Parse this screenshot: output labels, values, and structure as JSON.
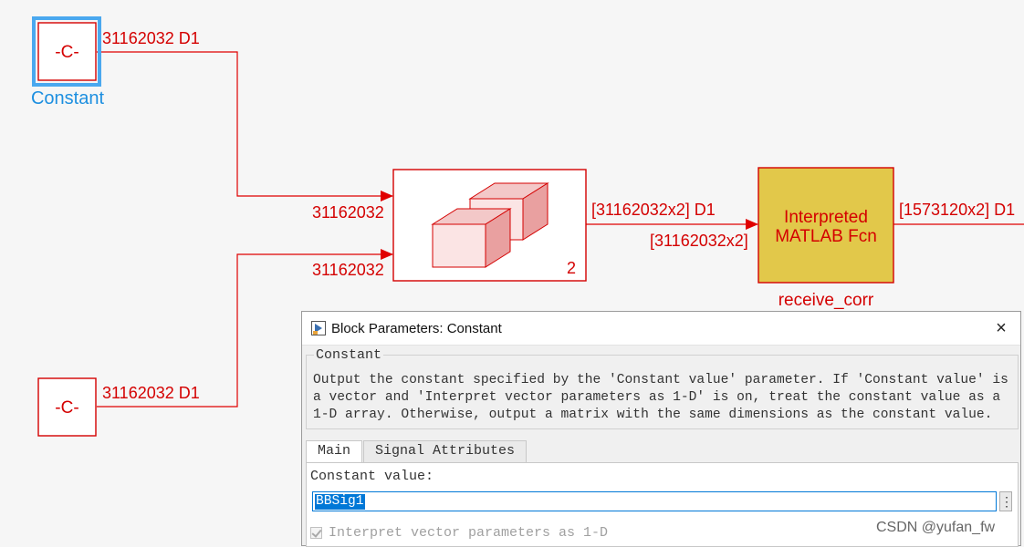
{
  "diagram": {
    "constant_block_1": {
      "symbol": "-C-",
      "name": "Constant",
      "output_signal": "31162032 D1"
    },
    "constant_block_2": {
      "symbol": "-C-",
      "output_signal": "31162032 D1"
    },
    "concatenate_block": {
      "input_1_dims": "31162032",
      "input_2_dims": "31162032",
      "num_inputs": "2",
      "output_signal": "[31162032x2] D1"
    },
    "interpreted_block": {
      "line1": "Interpreted",
      "line2": "MATLAB Fcn",
      "name": "receive_corr",
      "input_dims": "[31162032x2]",
      "output_signal": "[1573120x2] D1"
    }
  },
  "dialog": {
    "title": "Block Parameters: Constant",
    "close_symbol": "×",
    "group_title": "Constant",
    "description": "Output the constant specified by the 'Constant value' parameter. If 'Constant value' is a vector and 'Interpret vector parameters as 1-D' is on, treat the constant value as a 1-D array. Otherwise, output a matrix with the same dimensions as the constant value.",
    "tabs": [
      {
        "label": "Main",
        "active": true
      },
      {
        "label": "Signal Attributes",
        "active": false
      }
    ],
    "constant_value_label": "Constant value:",
    "constant_value": "BBSig1",
    "browse_symbol": "⋮",
    "checkbox_label": "Interpret vector parameters as 1-D",
    "checkbox_checked": true
  },
  "watermark": "CSDN @yufan_fw",
  "colors": {
    "signal_red": "#d40000",
    "block_fill_yellow": "#e2c84a",
    "selection_blue": "#4aa8ef",
    "constant_label_blue": "#1d8fe0"
  }
}
